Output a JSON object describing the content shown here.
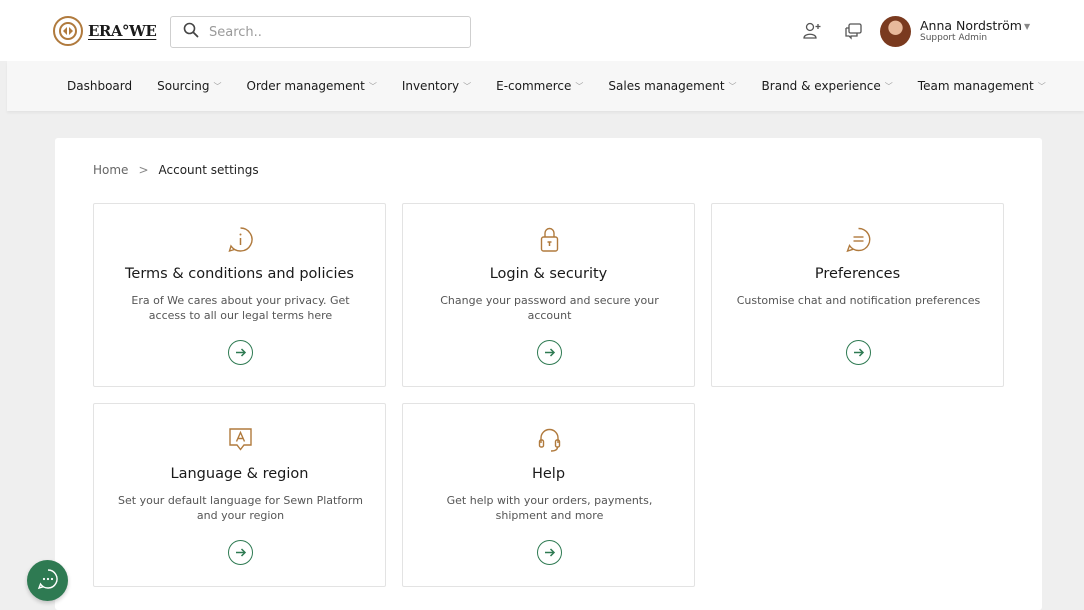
{
  "header": {
    "logo_text": "ERA°WE",
    "search": {
      "placeholder": "Search.."
    },
    "user": {
      "name": "Anna Nordström",
      "role": "Support Admin"
    }
  },
  "nav": {
    "items": [
      {
        "label": "Dashboard",
        "has_dropdown": false
      },
      {
        "label": "Sourcing",
        "has_dropdown": true
      },
      {
        "label": "Order management",
        "has_dropdown": true
      },
      {
        "label": "Inventory",
        "has_dropdown": true
      },
      {
        "label": "E-commerce",
        "has_dropdown": true
      },
      {
        "label": "Sales management",
        "has_dropdown": true
      },
      {
        "label": "Brand & experience",
        "has_dropdown": true
      },
      {
        "label": "Team management",
        "has_dropdown": true
      }
    ]
  },
  "breadcrumb": {
    "home": "Home",
    "separator": ">",
    "current": "Account settings"
  },
  "cards": [
    {
      "icon": "info-icon",
      "title": "Terms & conditions and policies",
      "description": "Era of We cares about your privacy. Get access to all our legal terms here"
    },
    {
      "icon": "lock-icon",
      "title": "Login & security",
      "description": "Change your password and secure your account"
    },
    {
      "icon": "chat-bubble-icon",
      "title": "Preferences",
      "description": "Customise chat and notification preferences"
    },
    {
      "icon": "language-icon",
      "title": "Language & region",
      "description": "Set your default language for Sewn Platform and your region"
    },
    {
      "icon": "headset-icon",
      "title": "Help",
      "description": "Get help with your orders, payments, shipment and more"
    }
  ],
  "colors": {
    "accent_brown": "#b07a3d",
    "accent_green": "#2e7a52"
  }
}
